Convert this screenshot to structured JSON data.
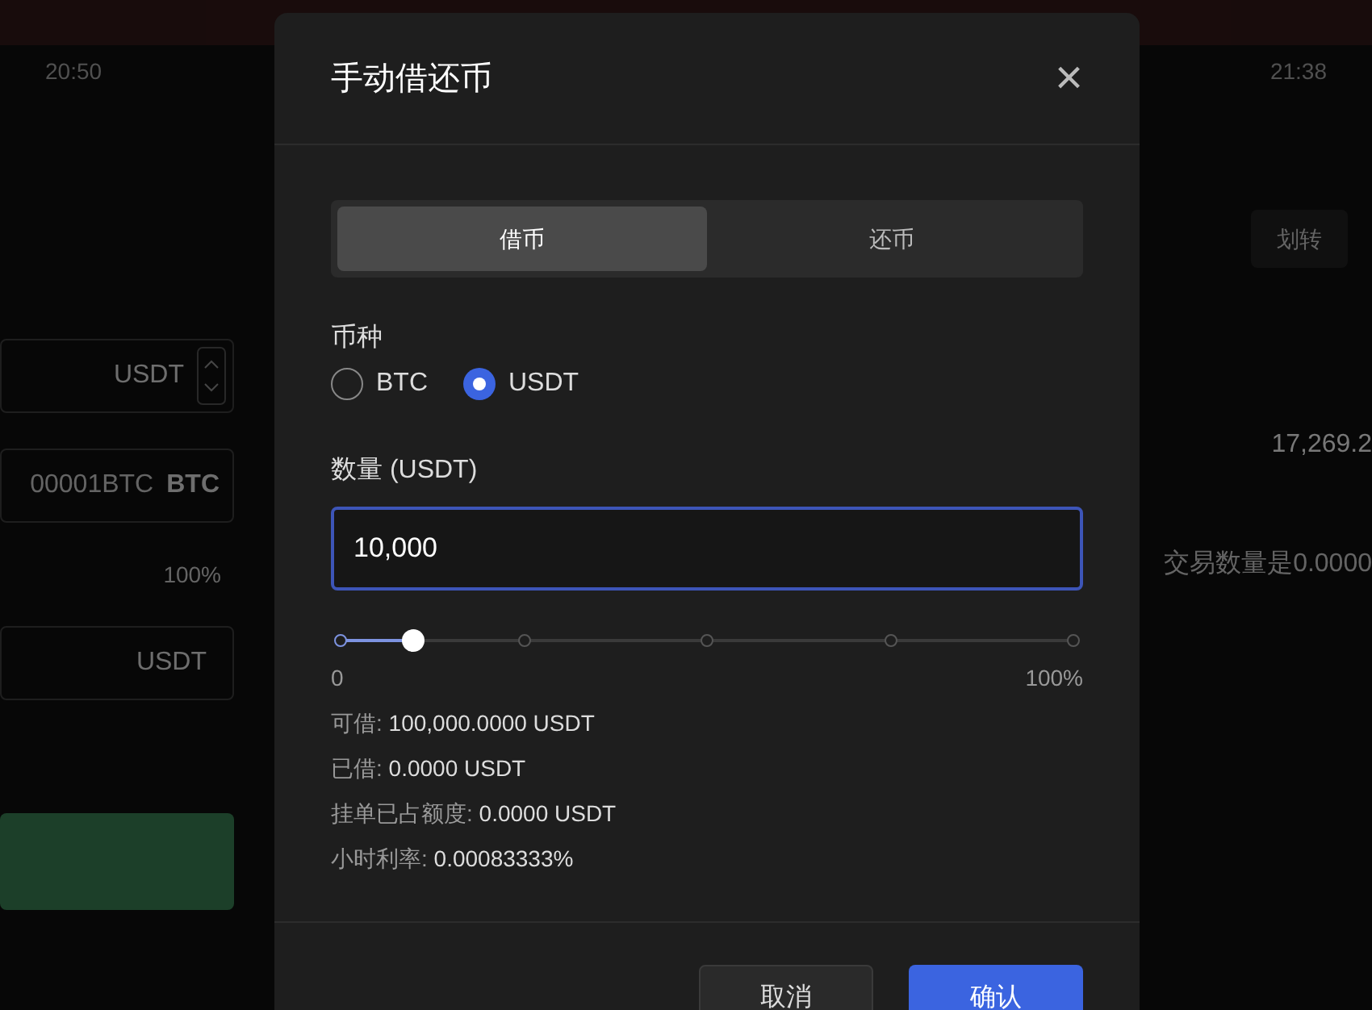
{
  "background": {
    "times": [
      "20:50",
      "21:38"
    ],
    "left_fields": [
      {
        "kind": "stepper",
        "text": "USDT"
      },
      {
        "kind": "pair",
        "text": "00001BTC",
        "unit": "BTC"
      },
      {
        "kind": "plain",
        "text": "100%"
      },
      {
        "kind": "field",
        "text": "USDT"
      }
    ],
    "transfer_button": "划转",
    "price": "17,269.2",
    "hint": "交易数量是0.0000"
  },
  "dialog": {
    "title": "手动借还币",
    "close": "×",
    "tabs": [
      {
        "label": "借币",
        "selected": true
      },
      {
        "label": "还币",
        "selected": false
      }
    ],
    "currency_label": "币种",
    "currencies": [
      {
        "label": "BTC",
        "selected": false
      },
      {
        "label": "USDT",
        "selected": true
      }
    ],
    "amount_label": "数量 (USDT)",
    "amount_value": "10,000",
    "slider": {
      "level": 0.1,
      "min_label": "0",
      "max_label": "100%"
    },
    "info": [
      {
        "label": "可借: ",
        "value": "100,000.0000 USDT"
      },
      {
        "label": "已借: ",
        "value": "0.0000 USDT"
      },
      {
        "label": "挂单已占额度: ",
        "value": "0.0000 USDT"
      },
      {
        "label": "小时利率: ",
        "value": "0.00083333%"
      }
    ],
    "buttons": [
      {
        "label": "取消",
        "kind": "secondary"
      },
      {
        "label": "确认",
        "kind": "primary"
      }
    ]
  }
}
